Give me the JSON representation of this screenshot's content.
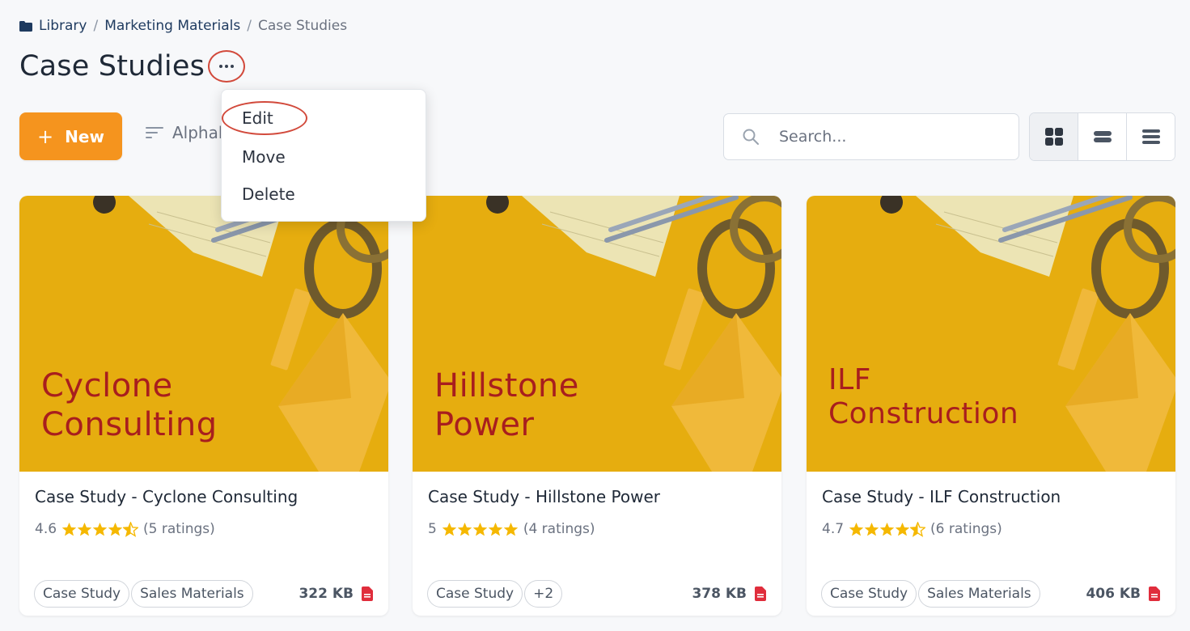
{
  "breadcrumb": {
    "items": [
      "Library",
      "Marketing Materials"
    ],
    "separator": "/",
    "current": "Case Studies"
  },
  "page": {
    "title": "Case Studies"
  },
  "toolbar": {
    "new_label": "New",
    "sort_label": "Alphabetical",
    "search_placeholder": "Search...",
    "views": [
      "grid-view-icon",
      "compact-list-icon",
      "list-view-icon"
    ]
  },
  "menu": {
    "items": [
      "Edit",
      "Move",
      "Delete"
    ]
  },
  "cards": [
    {
      "thumb_line1": "Cyclone",
      "thumb_line2": "Consulting",
      "title": "Case Study - Cyclone Consulting",
      "score": "4.6",
      "stars": 4.5,
      "ratings": "(5 ratings)",
      "tags": [
        "Case Study",
        "Sales Materials"
      ],
      "size": "322 KB"
    },
    {
      "thumb_line1": "Hillstone",
      "thumb_line2": "Power",
      "title": "Case Study - Hillstone Power",
      "score": "5",
      "stars": 5,
      "ratings": "(4 ratings)",
      "tags": [
        "Case Study",
        "+2"
      ],
      "size": "378 KB"
    },
    {
      "thumb_line1": "ILF",
      "thumb_line2": "Construction",
      "title": "Case Study - ILF Construction",
      "score": "4.7",
      "stars": 4.5,
      "ratings": "(6 ratings)",
      "tags": [
        "Case Study",
        "Sales Materials"
      ],
      "size": "406 KB"
    }
  ],
  "colors": {
    "accent": "#f5941e",
    "annotation": "#d24a3c",
    "thumb_bg": "#e6ad0f",
    "thumb_text": "#a81e1e",
    "star": "#f5b800",
    "pdf": "#e02d3c"
  }
}
